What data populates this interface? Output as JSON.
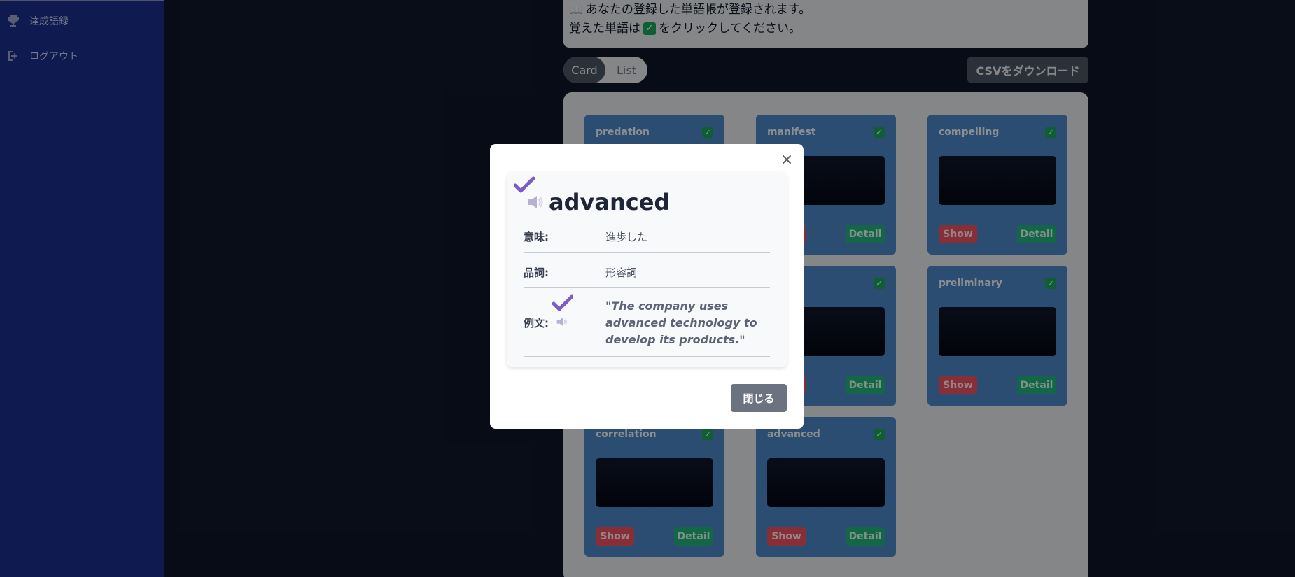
{
  "sidebar": {
    "items": [
      {
        "label": "達成語録",
        "icon": "trophy-icon"
      },
      {
        "label": "ログアウト",
        "icon": "logout-icon"
      }
    ]
  },
  "notice": {
    "line1_icon": "📖",
    "line1": "あなたの登録した単語帳が登録されます。",
    "line2_before": "覚えた単語は",
    "line2_check": "✓",
    "line2_after": "をクリックしてください。"
  },
  "view_toggle": {
    "card": "Card",
    "list": "List",
    "active": "Card"
  },
  "csv_button": "CSVをダウンロード",
  "cards": [
    {
      "word": "predation"
    },
    {
      "word": "manifest"
    },
    {
      "word": "compelling"
    },
    {
      "word": ""
    },
    {
      "word": ""
    },
    {
      "word": "preliminary"
    },
    {
      "word": "correlation"
    },
    {
      "word": "advanced"
    }
  ],
  "card_buttons": {
    "show": "Show",
    "detail": "Detail"
  },
  "modal": {
    "close_glyph": "×",
    "word": "advanced",
    "meaning_label": "意味:",
    "meaning": "進歩した",
    "pos_label": "品詞:",
    "pos": "形容詞",
    "example_label": "例文:",
    "example": "\"The company uses advanced technology to develop its products.\"",
    "footer_button": "閉じる"
  },
  "colors": {
    "sidebar": "#1a2d8a",
    "card": "#4a86c4",
    "show": "#ea5060",
    "detail": "#22b07d",
    "check": "#1aa35a",
    "accent_check": "#7c5cc4"
  }
}
